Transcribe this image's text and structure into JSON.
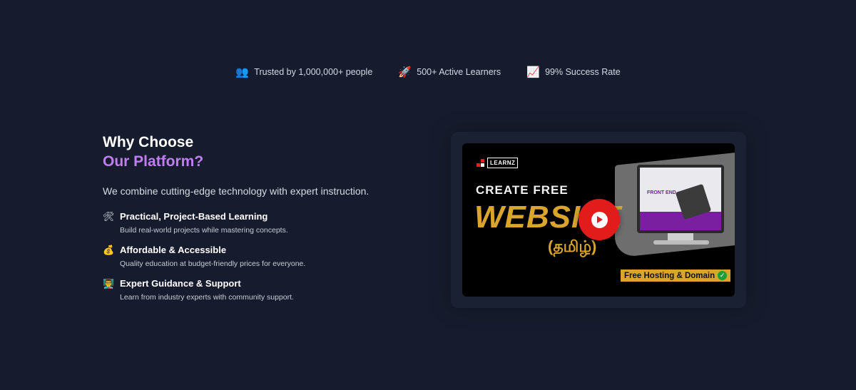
{
  "stats": [
    {
      "icon": "👥",
      "icon_name": "people-icon",
      "label": "Trusted by 1,000,000+ people"
    },
    {
      "icon": "🚀",
      "icon_name": "rocket-icon",
      "label": "500+ Active Learners"
    },
    {
      "icon": "📈",
      "icon_name": "chart-up-icon",
      "label": "99% Success Rate"
    }
  ],
  "section": {
    "title_line1": "Why Choose",
    "title_line2": "Our Platform?",
    "subtitle": "We combine cutting-edge technology with expert instruction."
  },
  "features": [
    {
      "icon": "🛠",
      "icon_name": "tools-icon",
      "title": "Practical, Project-Based Learning",
      "desc": "Build real-world projects while mastering concepts."
    },
    {
      "icon": "💰",
      "icon_name": "money-bag-icon",
      "title": "Affordable & Accessible",
      "desc": "Quality education at budget-friendly prices for everyone."
    },
    {
      "icon": "👨‍🏫",
      "icon_name": "teacher-icon",
      "title": "Expert Guidance & Support",
      "desc": "Learn from industry experts with community support."
    }
  ],
  "video": {
    "logo": "LEARNZ",
    "headline": "CREATE FREE",
    "big_text": "WEBSITE",
    "tamil": "(தமிழ்)",
    "monitor_text": "FRONT END",
    "badge": "Free Hosting  & Domain",
    "check": "✓"
  },
  "colors": {
    "background": "#161c2d",
    "accent": "#c07ef2",
    "play": "#e21b1b",
    "gold": "#d9a52b"
  }
}
